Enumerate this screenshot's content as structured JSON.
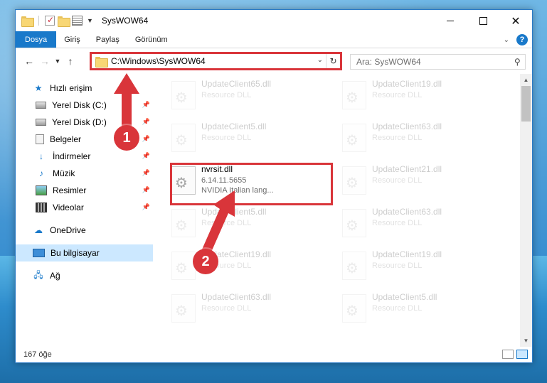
{
  "window": {
    "title": "SysWOW64"
  },
  "ribbon": {
    "tabs": [
      "Dosya",
      "Giriş",
      "Paylaş",
      "Görünüm"
    ]
  },
  "address": {
    "path": "C:\\Windows\\SysWOW64",
    "search_placeholder": "Ara: SysWOW64"
  },
  "nav": {
    "quick_access": "Hızlı erişim",
    "items": [
      "Yerel Disk (C:)",
      "Yerel Disk (D:)",
      "Belgeler",
      "İndirmeler",
      "Müzik",
      "Resimler",
      "Videolar"
    ],
    "onedrive": "OneDrive",
    "this_pc": "Bu bilgisayar",
    "network": "Ağ"
  },
  "files": {
    "left_column": [
      {
        "name": "UpdateClient65.dll",
        "sub": "Resource DLL"
      },
      {
        "name": "UpdateClient5.dll",
        "sub": "Resource DLL"
      },
      {
        "name": "nvrsit.dll",
        "version": "6.14.11.5655",
        "desc": "NVIDIA Italian lang..."
      },
      {
        "name": "UpdateClient5.dll",
        "sub": "Resource DLL"
      },
      {
        "name": "UpdateClient19.dll",
        "sub": "Resource DLL"
      },
      {
        "name": "UpdateClient63.dll",
        "sub": "Resource DLL"
      }
    ],
    "right_column": [
      {
        "name": "UpdateClient19.dll",
        "sub": "Resource DLL"
      },
      {
        "name": "UpdateClient63.dll",
        "sub": "Resource DLL"
      },
      {
        "name": "UpdateClient21.dll",
        "sub": "Resource DLL"
      },
      {
        "name": "UpdateClient63.dll",
        "sub": "Resource DLL"
      },
      {
        "name": "UpdateClient19.dll",
        "sub": "Resource DLL"
      },
      {
        "name": "UpdateClient5.dll",
        "sub": "Resource DLL"
      }
    ]
  },
  "status": {
    "count": "167 öğe"
  },
  "annotations": {
    "step1": "1",
    "step2": "2",
    "color": "#d9353a"
  }
}
